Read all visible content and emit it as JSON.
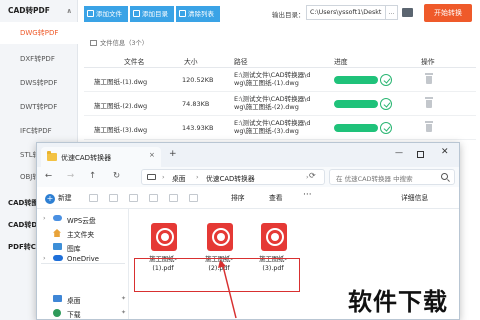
{
  "sidebar": {
    "header": "CAD转PDF",
    "items": [
      {
        "label": "DWG转PDF",
        "active": true
      },
      {
        "label": "DXF转PDF"
      },
      {
        "label": "DWS转PDF"
      },
      {
        "label": "DWT转PDF"
      },
      {
        "label": "IFC转PDF"
      },
      {
        "label": "STL转PDF"
      },
      {
        "label": "OBJ转PDF"
      }
    ],
    "groups": [
      "CAD转图片",
      "CAD转DWF",
      "PDF转CAD"
    ]
  },
  "toolbar": {
    "add_file": "添加文件",
    "add_folder": "添加目录",
    "clear_list": "清除列表",
    "output_label": "输出目录：",
    "output_path": "C:\\Users\\yssoft1\\Deskt",
    "output_more": "...",
    "start": "开始转换"
  },
  "file_info": "文件信息（3个）",
  "table": {
    "columns": [
      "文件名",
      "大小",
      "路径",
      "进度",
      "操作"
    ],
    "rows": [
      {
        "name": "施工图纸-(1).dwg",
        "size": "120.52KB",
        "path_line1": "E:\\测试文件\\CAD转换器\\d",
        "path_line2": "wg\\施工图纸-(1).dwg",
        "progress": 1.0
      },
      {
        "name": "施工图纸-(2).dwg",
        "size": "74.83KB",
        "path_line1": "E:\\测试文件\\CAD转换器\\d",
        "path_line2": "wg\\施工图纸-(2).dwg",
        "progress": 1.0
      },
      {
        "name": "施工图纸-(3).dwg",
        "size": "143.93KB",
        "path_line1": "E:\\测试文件\\CAD转换器\\d",
        "path_line2": "wg\\施工图纸-(3).dwg",
        "progress": 1.0
      }
    ]
  },
  "explorer": {
    "tab_title": "优速CAD转换器",
    "tab_close": "×",
    "new_tab": "+",
    "breadcrumb": [
      "桌面",
      "优速CAD转换器"
    ],
    "search_placeholder": "在 优速CAD转换器 中搜索",
    "new_label": "新建",
    "sort_label": "排序",
    "view_label": "查看",
    "more_label": "···",
    "details_label": "详细信息",
    "nav": {
      "wps": "WPS云盘",
      "home": "主文件夹",
      "gallery": "图库",
      "onedrive": "OneDrive",
      "desktop": "桌面",
      "downloads": "下载"
    },
    "files": [
      {
        "line1": "施工图纸-",
        "line2": "(1).pdf"
      },
      {
        "line1": "施工图纸-",
        "line2": "(2).pdf"
      },
      {
        "line1": "施工图纸-",
        "line2": "(3).pdf"
      }
    ]
  },
  "watermark": "软件下载",
  "colors": {
    "accent": "#ef5a2a",
    "toolbar_button": "#3aa3e6",
    "progress": "#1fc27a",
    "pdf": "#e53935",
    "highlight": "#d83030"
  }
}
